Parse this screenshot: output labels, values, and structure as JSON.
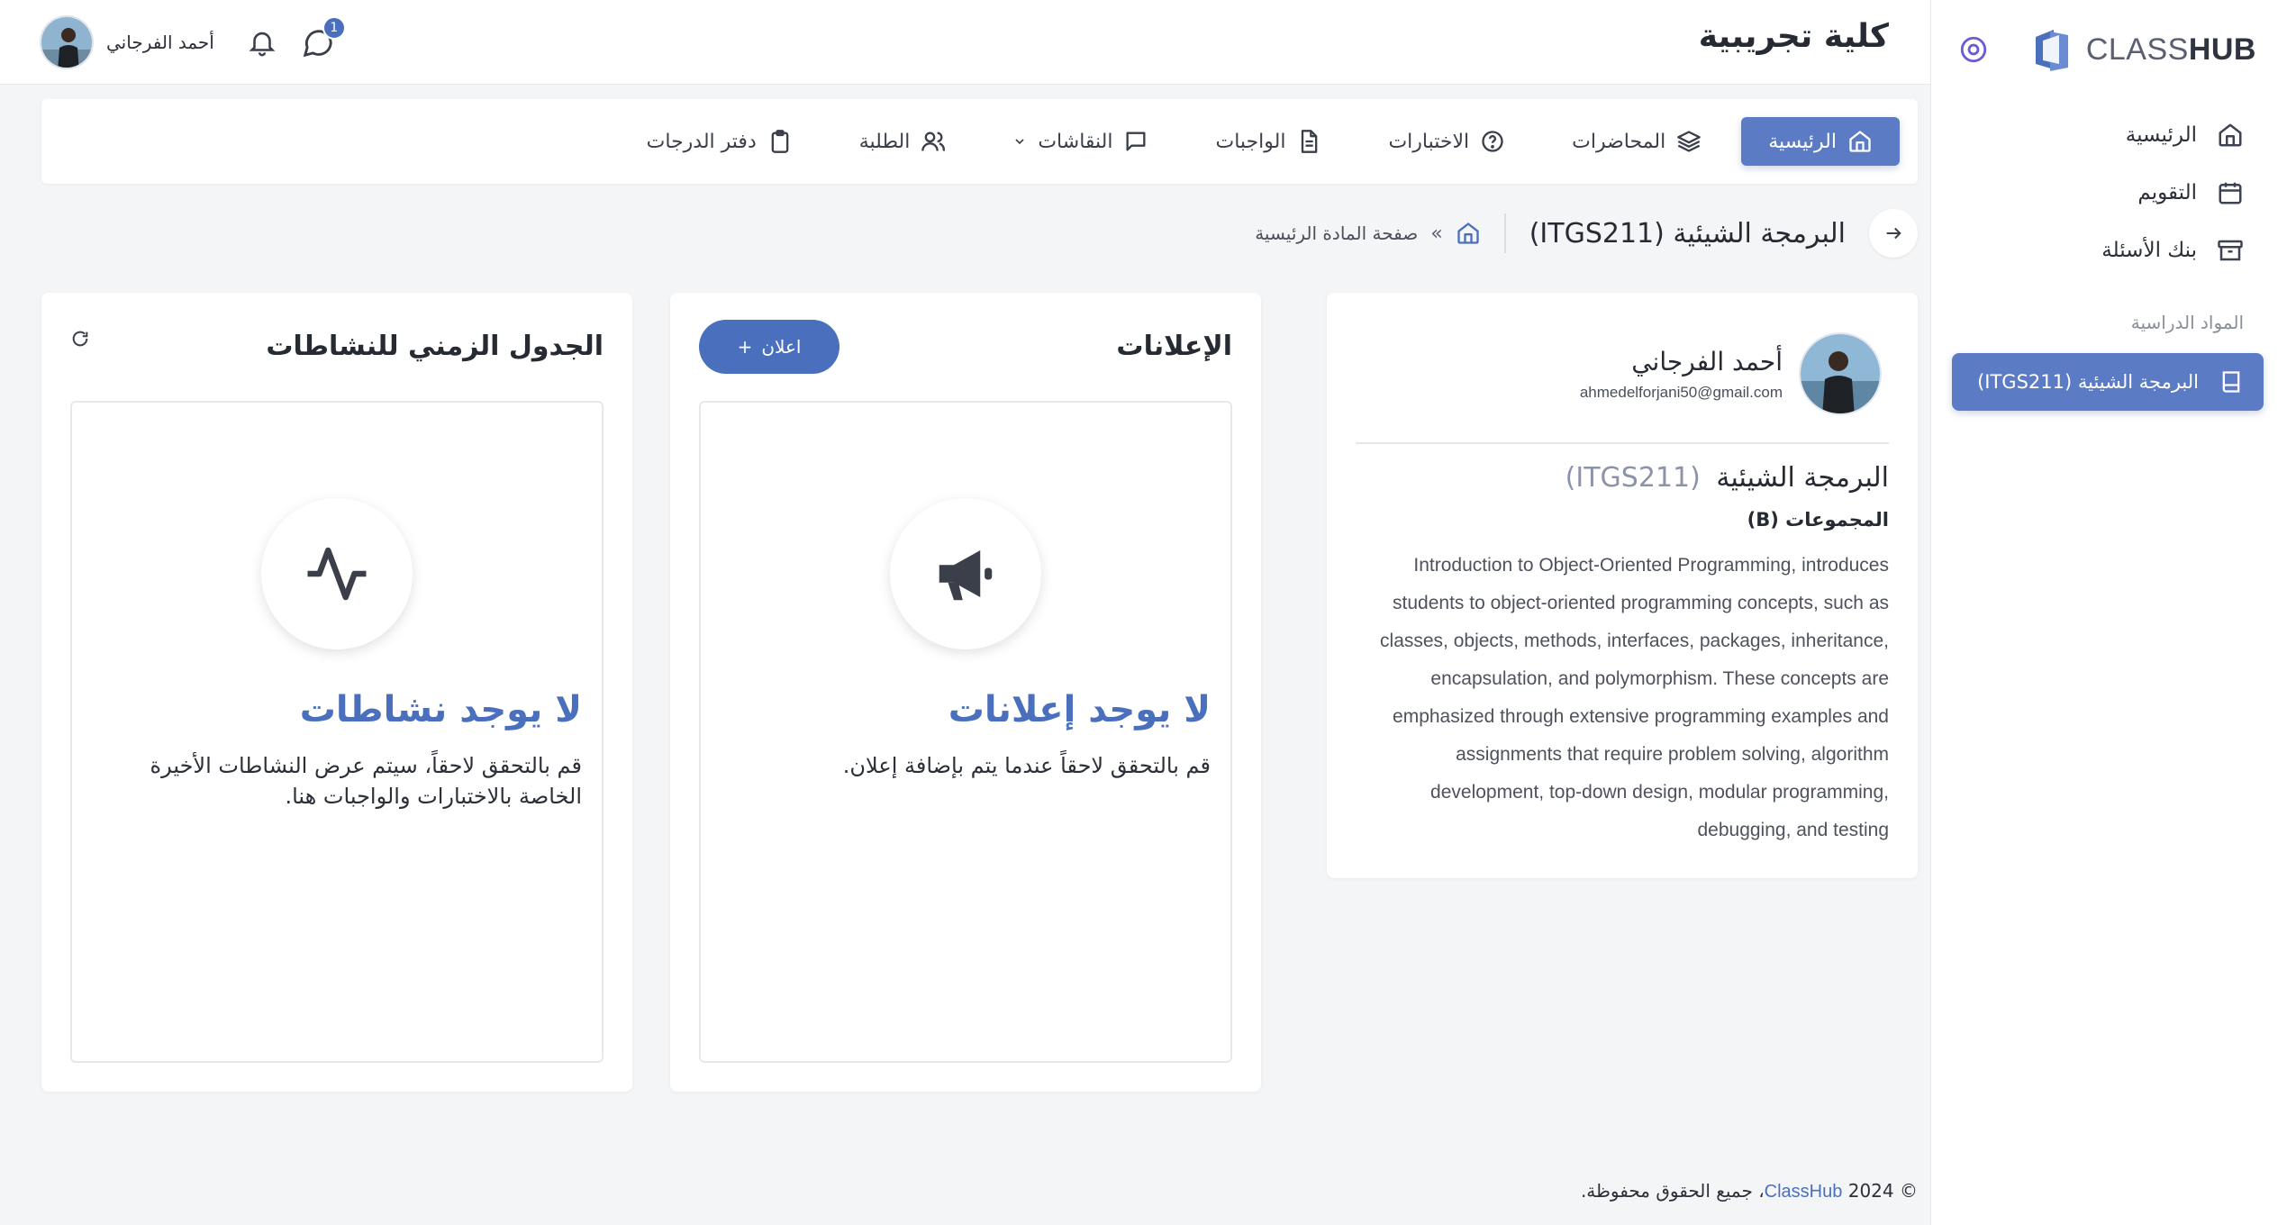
{
  "app": {
    "brand_light": "CLASS",
    "brand_bold": "HUB",
    "college_name": "كلية تجريبية"
  },
  "sidebar": {
    "items": [
      {
        "label": "الرئيسية",
        "icon": "home-icon"
      },
      {
        "label": "التقويم",
        "icon": "calendar-icon"
      },
      {
        "label": "بنك الأسئلة",
        "icon": "archive-icon"
      }
    ],
    "section_label": "المواد الدراسية",
    "course_item": {
      "label": "البرمجة الشيئية (ITGS211)",
      "icon": "book-icon"
    }
  },
  "header": {
    "user_name": "أحمد الفرجاني",
    "notifications_icon": "bell-icon",
    "messages_icon": "chat-icon",
    "messages_badge": "1"
  },
  "tabs": [
    {
      "label": "الرئيسية",
      "icon": "home-icon",
      "active": true
    },
    {
      "label": "المحاضرات",
      "icon": "layers-icon"
    },
    {
      "label": "الاختبارات",
      "icon": "help-circle-icon"
    },
    {
      "label": "الواجبات",
      "icon": "file-text-icon"
    },
    {
      "label": "النقاشات",
      "icon": "message-square-icon",
      "dropdown": true
    },
    {
      "label": "الطلبة",
      "icon": "users-icon"
    },
    {
      "label": "دفتر الدرجات",
      "icon": "clipboard-icon"
    }
  ],
  "breadcrumb": {
    "title": "البرمجة الشيئية (ITGS211)",
    "separator": "»",
    "page": "صفحة المادة الرئيسية"
  },
  "course_card": {
    "instructor_name": "أحمد الفرجاني",
    "instructor_email": "ahmedelforjani50@gmail.com",
    "course_name": "البرمجة الشيئية",
    "course_code": "(ITGS211)",
    "groups_label": "المجموعات (B)",
    "description": "Introduction to Object-Oriented Programming, introduces students to object-oriented programming concepts, such as classes, objects, methods, interfaces, packages, inheritance, encapsulation, and polymorphism. These concepts are emphasized through extensive programming examples and assignments that require problem solving, algorithm development, top-down design, modular programming, debugging, and testing"
  },
  "announcements": {
    "title": "الإعلانات",
    "add_button": "اعلان",
    "add_button_icon": "+",
    "empty_title": "لا يوجد إعلانات",
    "empty_text": "قم بالتحقق لاحقاً عندما يتم بإضافة إعلان.",
    "empty_icon": "megaphone-icon"
  },
  "timeline": {
    "title": "الجدول الزمني للنشاطات",
    "empty_title": "لا يوجد نشاطات",
    "empty_text": "قم بالتحقق لاحقاً، سيتم عرض النشاطات الأخيرة الخاصة بالاختبارات والواجبات هنا.",
    "empty_icon": "activity-icon"
  },
  "footer": {
    "prefix": "© 2024",
    "brand": "ClassHub",
    "suffix": "، جميع الحقوق محفوظة."
  },
  "colors": {
    "primary": "#4a6fbd",
    "active_tab": "#5b7bc4",
    "background": "#f4f5f7"
  }
}
